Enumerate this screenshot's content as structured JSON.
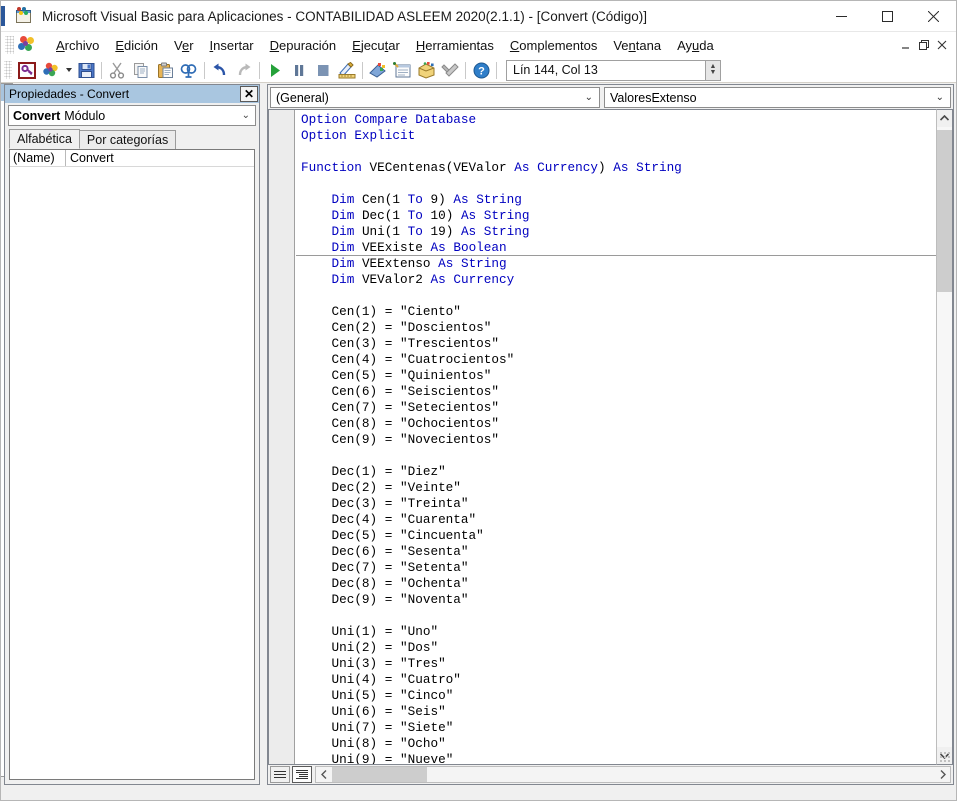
{
  "window": {
    "title": "Microsoft Visual Basic para Aplicaciones - CONTABILIDAD ASLEEM 2020(2.1.1) - [Convert (Código)]",
    "app_icon": "vba-document-icon",
    "minimize_label": "Minimizar",
    "maximize_label": "Maximizar",
    "close_label": "Cerrar"
  },
  "menubar": {
    "logo": "vba-logo-icon",
    "items": [
      {
        "label": "Archivo",
        "accel": "A"
      },
      {
        "label": "Edición",
        "accel": "E"
      },
      {
        "label": "Ver",
        "accel": "V"
      },
      {
        "label": "Insertar",
        "accel": "I"
      },
      {
        "label": "Depuración",
        "accel": "D"
      },
      {
        "label": "Ejecutar",
        "accel": "E"
      },
      {
        "label": "Herramientas",
        "accel": "H"
      },
      {
        "label": "Complementos",
        "accel": "C"
      },
      {
        "label": "Ventana",
        "accel": "n"
      },
      {
        "label": "Ayuda",
        "accel": "u"
      }
    ],
    "mdi_minimize": "_",
    "mdi_restore": "❐",
    "mdi_close": "✕"
  },
  "toolbar": {
    "buttons": [
      {
        "name": "view-excel-icon",
        "tip": "Ver Microsoft Access"
      },
      {
        "name": "insert-object-icon",
        "tip": "Insertar"
      },
      {
        "name": "save-icon",
        "tip": "Guardar"
      },
      {
        "name": "cut-icon",
        "tip": "Cortar"
      },
      {
        "name": "copy-icon",
        "tip": "Copiar"
      },
      {
        "name": "paste-icon",
        "tip": "Pegar"
      },
      {
        "name": "find-icon",
        "tip": "Buscar"
      },
      {
        "name": "undo-icon",
        "tip": "Deshacer"
      },
      {
        "name": "redo-icon",
        "tip": "Rehacer"
      },
      {
        "name": "run-icon",
        "tip": "Ejecutar Sub/UserForm"
      },
      {
        "name": "pause-icon",
        "tip": "Interrumpir"
      },
      {
        "name": "stop-icon",
        "tip": "Restablecer"
      },
      {
        "name": "design-mode-icon",
        "tip": "Modo de diseño"
      },
      {
        "name": "project-explorer-icon",
        "tip": "Explorador de proyectos"
      },
      {
        "name": "properties-window-icon",
        "tip": "Ventana Propiedades"
      },
      {
        "name": "object-browser-icon",
        "tip": "Examinador de objetos"
      },
      {
        "name": "toolbox-icon",
        "tip": "Cuadro de herramientas"
      },
      {
        "name": "help-icon",
        "tip": "Ayuda"
      }
    ],
    "position_status": "Lín 144, Col 13"
  },
  "properties_panel": {
    "title": "Propiedades - Convert",
    "close_icon": "close-icon",
    "object_name": "Convert",
    "object_type": "Módulo",
    "dropdown_icon": "chevron-down-icon",
    "tabs": [
      {
        "label": "Alfabética",
        "active": true
      },
      {
        "label": "Por categorías",
        "active": false
      }
    ],
    "rows": [
      {
        "key": "(Name)",
        "value": "Convert"
      }
    ]
  },
  "code_window": {
    "object_combo": "(General)",
    "procedure_combo": "ValoresExtenso",
    "dropdown_icon": "chevron-down-icon",
    "view_procedure_icon": "procedure-view-icon",
    "view_fullmodule_icon": "full-module-view-icon",
    "scroll_up_icon": "chevron-up-icon",
    "scroll_down_icon": "chevron-down-icon",
    "scroll_left_icon": "chevron-left-icon",
    "scroll_right_icon": "chevron-right-icon",
    "declarations": [
      "Option Compare Database",
      "Option Explicit"
    ],
    "function_signature": "Function VECentenas(VEValor As Currency) As String",
    "dim_statements": [
      "Dim Cen(1 To 9) As String",
      "Dim Dec(1 To 10) As String",
      "Dim Uni(1 To 19) As String",
      "Dim VEExiste As Boolean",
      "Dim VEExtenso As String",
      "Dim VEValor2 As Currency"
    ],
    "cen_assignments": [
      "Cen(1) = \"Ciento\"",
      "Cen(2) = \"Doscientos\"",
      "Cen(3) = \"Trescientos\"",
      "Cen(4) = \"Cuatrocientos\"",
      "Cen(5) = \"Quinientos\"",
      "Cen(6) = \"Seiscientos\"",
      "Cen(7) = \"Setecientos\"",
      "Cen(8) = \"Ochocientos\"",
      "Cen(9) = \"Novecientos\""
    ],
    "dec_assignments": [
      "Dec(1) = \"Diez\"",
      "Dec(2) = \"Veinte\"",
      "Dec(3) = \"Treinta\"",
      "Dec(4) = \"Cuarenta\"",
      "Dec(5) = \"Cincuenta\"",
      "Dec(6) = \"Sesenta\"",
      "Dec(7) = \"Setenta\"",
      "Dec(8) = \"Ochenta\"",
      "Dec(9) = \"Noventa\""
    ],
    "uni_assignments": [
      "Uni(1) = \"Uno\"",
      "Uni(2) = \"Dos\"",
      "Uni(3) = \"Tres\"",
      "Uni(4) = \"Cuatro\"",
      "Uni(5) = \"Cinco\"",
      "Uni(6) = \"Seis\"",
      "Uni(7) = \"Siete\"",
      "Uni(8) = \"Ocho\"",
      "Uni(9) = \"Nueve\""
    ],
    "code_text": "Option Compare Database\nOption Explicit\n\nFunction VECentenas(VEValor As Currency) As String\n\n    Dim Cen(1 To 9) As String\n    Dim Dec(1 To 10) As String\n    Dim Uni(1 To 19) As String\n    Dim VEExiste As Boolean\n    Dim VEExtenso As String\n    Dim VEValor2 As Currency\n\n    Cen(1) = \"Ciento\"\n    Cen(2) = \"Doscientos\"\n    Cen(3) = \"Trescientos\"\n    Cen(4) = \"Cuatrocientos\"\n    Cen(5) = \"Quinientos\"\n    Cen(6) = \"Seiscientos\"\n    Cen(7) = \"Setecientos\"\n    Cen(8) = \"Ochocientos\"\n    Cen(9) = \"Novecientos\"\n\n    Dec(1) = \"Diez\"\n    Dec(2) = \"Veinte\"\n    Dec(3) = \"Treinta\"\n    Dec(4) = \"Cuarenta\"\n    Dec(5) = \"Cincuenta\"\n    Dec(6) = \"Sesenta\"\n    Dec(7) = \"Setenta\"\n    Dec(8) = \"Ochenta\"\n    Dec(9) = \"Noventa\"\n\n    Uni(1) = \"Uno\"\n    Uni(2) = \"Dos\"\n    Uni(3) = \"Tres\"\n    Uni(4) = \"Cuatro\"\n    Uni(5) = \"Cinco\"\n    Uni(6) = \"Seis\"\n    Uni(7) = \"Siete\"\n    Uni(8) = \"Ocho\"\n    Uni(9) = \"Nueve\""
  },
  "colors": {
    "keyword": "#0000C0",
    "identifier": "#000000",
    "titlebar_accent": "#2B579A",
    "panel_title_bg": "#A9C6E0",
    "code_bg": "#FFFFFF"
  }
}
